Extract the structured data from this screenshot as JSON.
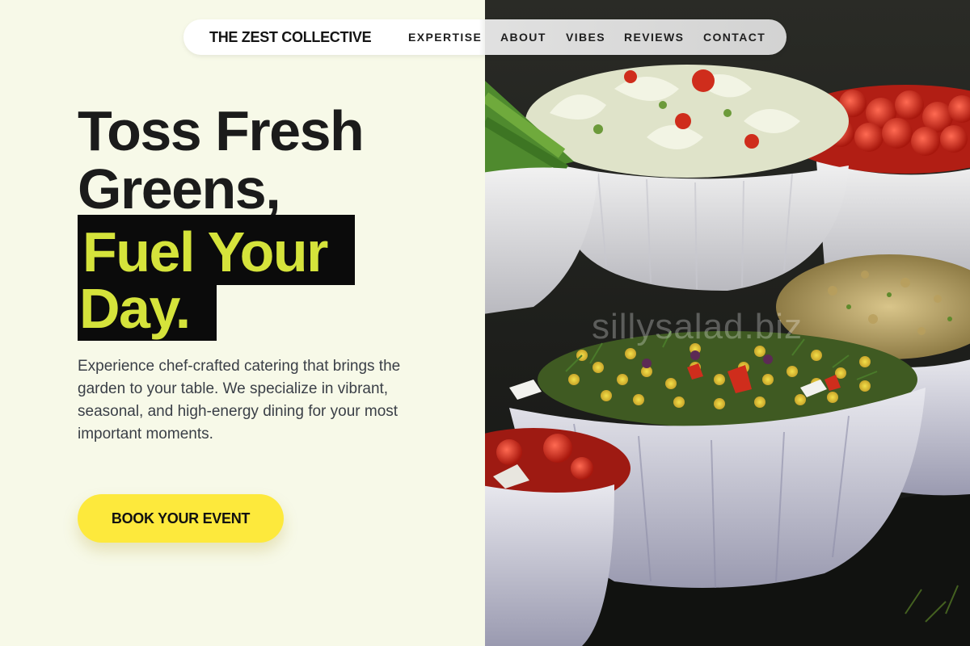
{
  "nav": {
    "brand": "THE ZEST COLLECTIVE",
    "links": [
      "EXPERTISE",
      "ABOUT",
      "VIBES",
      "REVIEWS",
      "CONTACT"
    ]
  },
  "hero": {
    "headline_line1": "Toss Fresh",
    "headline_line2": "Greens,",
    "headline_line3": "Fuel Your",
    "headline_line4": "Day.",
    "description": "Experience chef-crafted catering that brings the garden to your table. We specialize in vibrant, seasonal, and high-energy dining for your most important moments.",
    "cta_label": "BOOK YOUR EVENT"
  },
  "image": {
    "watermark": "sillysalad.biz"
  },
  "colors": {
    "background": "#f7f9e8",
    "accent_lime": "#d5e33b",
    "cta_yellow": "#fde93c",
    "text_dark": "#1b1b1b"
  }
}
